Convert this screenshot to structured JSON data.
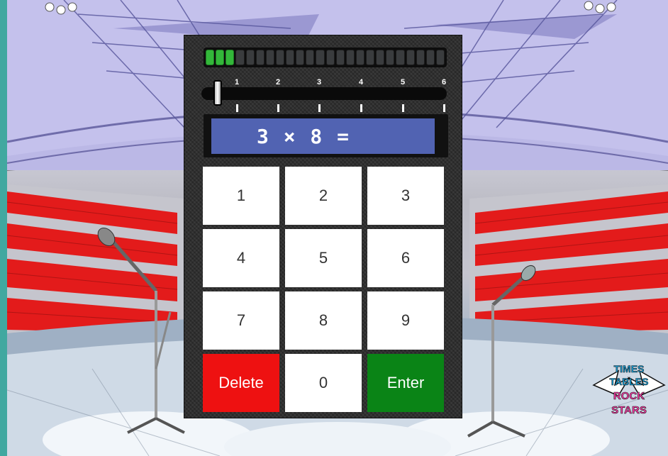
{
  "game": {
    "progress_filled": 3,
    "progress_total": 24,
    "slider": {
      "ticks": [
        "1",
        "2",
        "3",
        "4",
        "5",
        "6"
      ],
      "value": 0
    },
    "question": "3 × 8 ="
  },
  "keypad": {
    "keys": [
      "1",
      "2",
      "3",
      "4",
      "5",
      "6",
      "7",
      "8",
      "9"
    ],
    "delete_label": "Delete",
    "zero_label": "0",
    "enter_label": "Enter"
  },
  "colors": {
    "progress_on": "#33b73a",
    "display_bg": "#5163b2",
    "delete_bg": "#ee1111",
    "enter_bg": "#0a8416"
  },
  "logo": {
    "text": "TIMES TABLES ROCK STARS"
  }
}
